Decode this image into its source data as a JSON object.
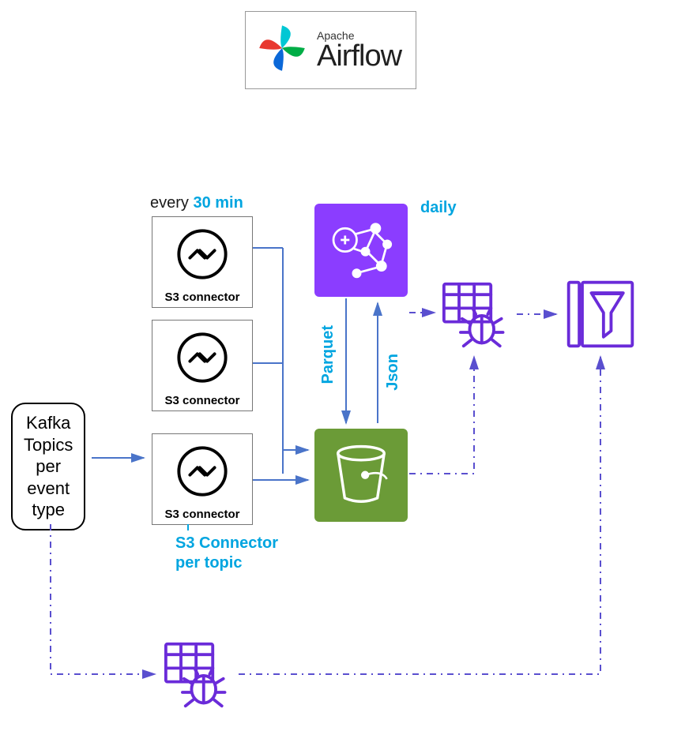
{
  "airflow": {
    "small": "Apache",
    "big": "Airflow"
  },
  "kafka": {
    "line1": "Kafka",
    "line2": "Topics",
    "line3": "per",
    "line4": "event",
    "line5": "type"
  },
  "s3connector_label": "S3 connector",
  "labels": {
    "every": "every",
    "thirty": "30 min",
    "daily": "daily",
    "parquet": "Parquet",
    "json": "Json",
    "s3conn_per_topic_1": "S3 Connector",
    "s3conn_per_topic_2": "per topic"
  },
  "colors": {
    "accent": "#00a5e0",
    "emr": "#8b3dff",
    "s3": "#6b9b37",
    "glue": "#6a2bd9",
    "arrow": "#4a74c9",
    "dash": "#5a4fcf"
  }
}
